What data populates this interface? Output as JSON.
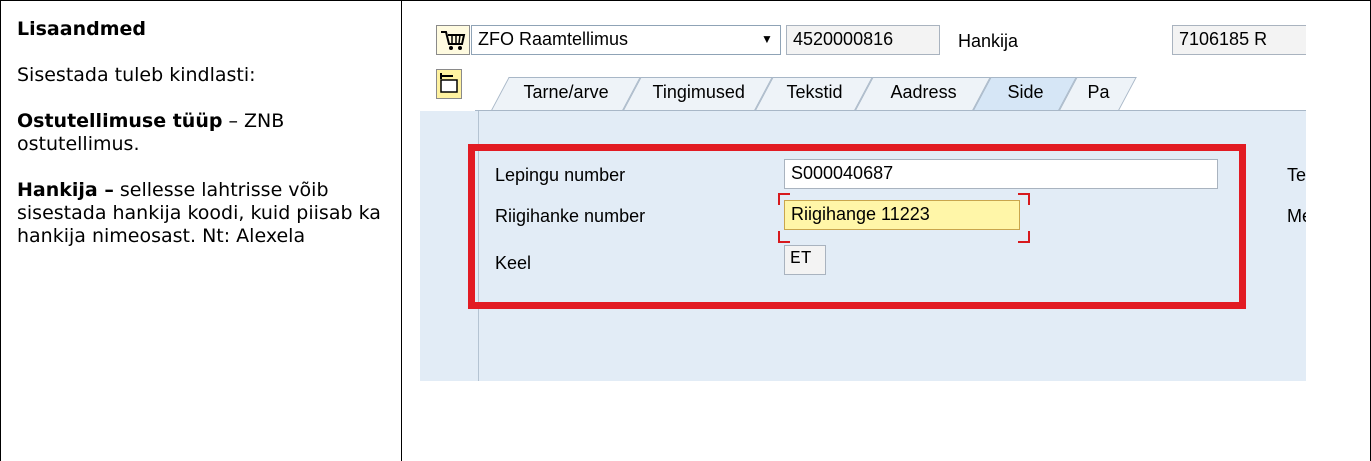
{
  "doc": {
    "heading": "Lisaandmed",
    "intro": "Sisestada tuleb kindlasti:",
    "order_type_label": "Ostutellimuse tüüp",
    "order_type_desc": " – ZNB ostutellimus.",
    "vendor_label": "Hankija –",
    "vendor_desc": " sellesse lahtrisse võib sisestada hankija koodi, kuid piisab ka hankija nimeosast. Nt: Alexela"
  },
  "sap": {
    "header": {
      "doc_type": "ZFO Raamtellimus",
      "po_number": "4520000816",
      "vendor_label": "Hankija",
      "vendor_value": "7106185 R"
    },
    "tabs": [
      "Tarne/arve",
      "Tingimused",
      "Tekstid",
      "Aadress",
      "Side",
      "Pa"
    ],
    "active_tab": "Side",
    "fields": {
      "contract_label": "Lepingu number",
      "contract_value": "S000040687",
      "procurement_label": "Riigihanke number",
      "procurement_value": "Riigihange 11223",
      "language_label": "Keel",
      "language_value": "ET",
      "right_label_1": "Te",
      "right_label_2": "Me"
    },
    "colors": {
      "highlight_border": "#e21b23",
      "active_field": "#fff6a8",
      "panel": "#e2ecf6"
    },
    "icons": [
      "shopping-cart-icon",
      "document-toggle-icon"
    ]
  }
}
